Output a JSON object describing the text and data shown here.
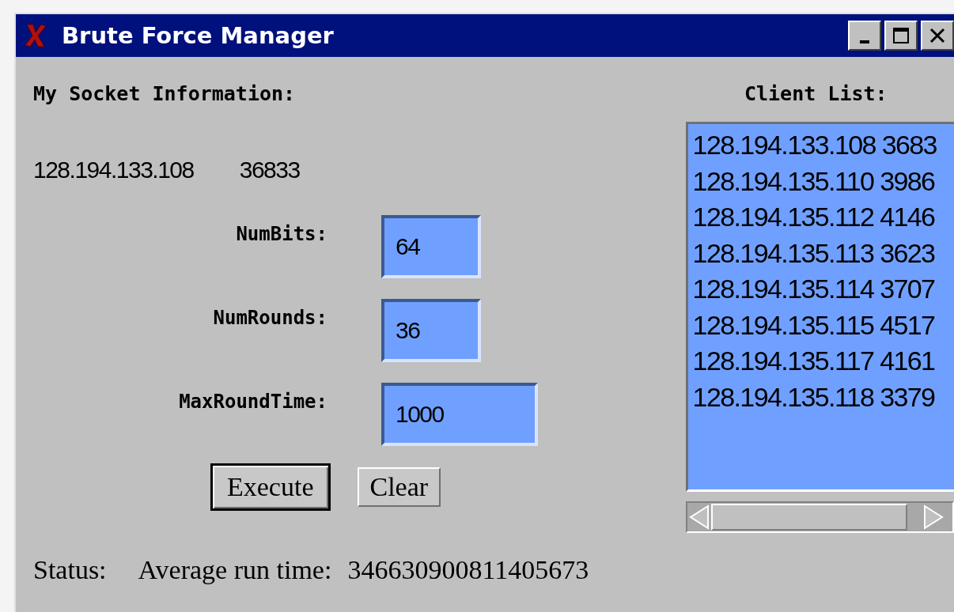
{
  "window": {
    "title": "Brute Force Manager"
  },
  "socket": {
    "heading": "My Socket Information:",
    "address": "128.194.133.108",
    "port": "36833"
  },
  "fields": [
    {
      "label": "NumBits:",
      "value": "64",
      "kind": "short"
    },
    {
      "label": "NumRounds:",
      "value": "36",
      "kind": "short"
    },
    {
      "label": "MaxRoundTime:",
      "value": "1000",
      "kind": "long"
    }
  ],
  "buttons": [
    {
      "label": "Execute",
      "default": true
    },
    {
      "label": "Clear",
      "default": false
    }
  ],
  "client_list": {
    "heading": "Client List:",
    "items": [
      "128.194.133.108 3683",
      "128.194.135.110 3986",
      "128.194.135.112 4146",
      "128.194.135.113 3623",
      "128.194.135.114 3707",
      "128.194.135.115 4517",
      "128.194.135.117 4161",
      "128.194.135.118 3379"
    ]
  },
  "status": {
    "label": "Status:",
    "message": "Average run time:",
    "value": "346630900811405673"
  }
}
